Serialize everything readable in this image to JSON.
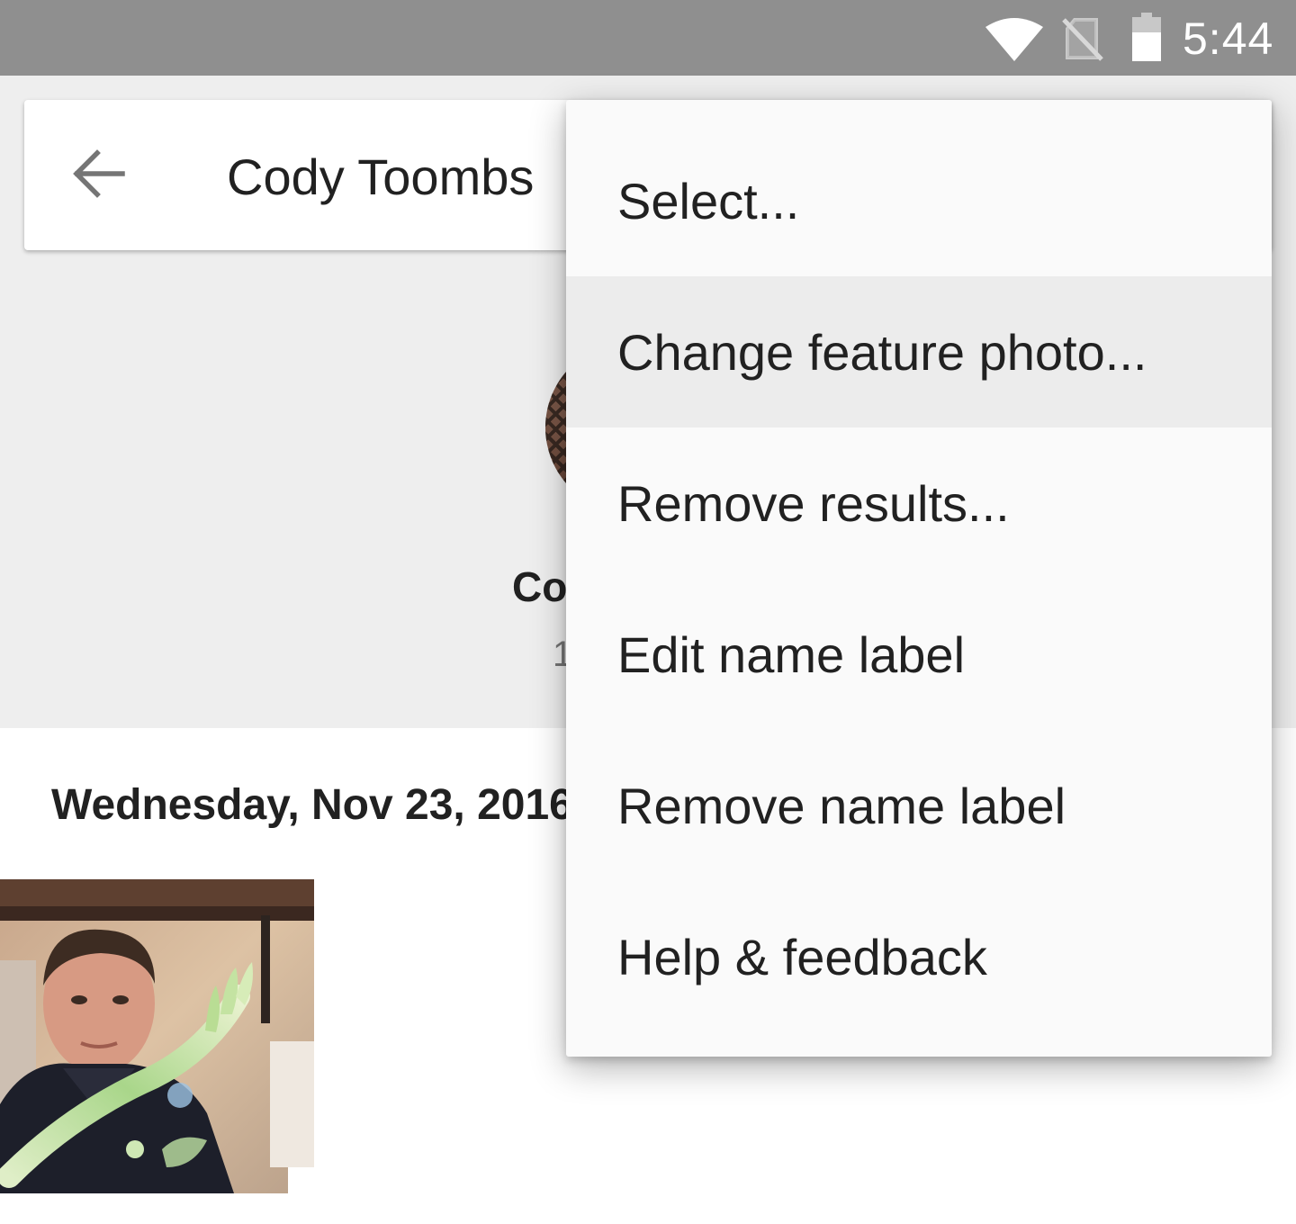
{
  "status_bar": {
    "time": "5:44",
    "icons": [
      "wifi-icon",
      "no-sim-icon",
      "battery-icon"
    ]
  },
  "header": {
    "title": "Cody Toombs",
    "back_icon": "arrow-back-icon"
  },
  "person": {
    "name": "Co",
    "count": "1"
  },
  "timeline": {
    "date": "Wednesday, Nov 23, 2016"
  },
  "menu": {
    "items": [
      {
        "label": "Select..."
      },
      {
        "label": "Change feature photo..."
      },
      {
        "label": "Remove results..."
      },
      {
        "label": "Edit name label"
      },
      {
        "label": "Remove name label"
      },
      {
        "label": "Help & feedback"
      }
    ],
    "highlighted_index": 1
  },
  "colors": {
    "status_bar": "#8f8f8f",
    "header_background": "#eeeeee",
    "menu_background": "#fafafa",
    "menu_highlight": "#ececec",
    "text_primary": "#212121"
  }
}
